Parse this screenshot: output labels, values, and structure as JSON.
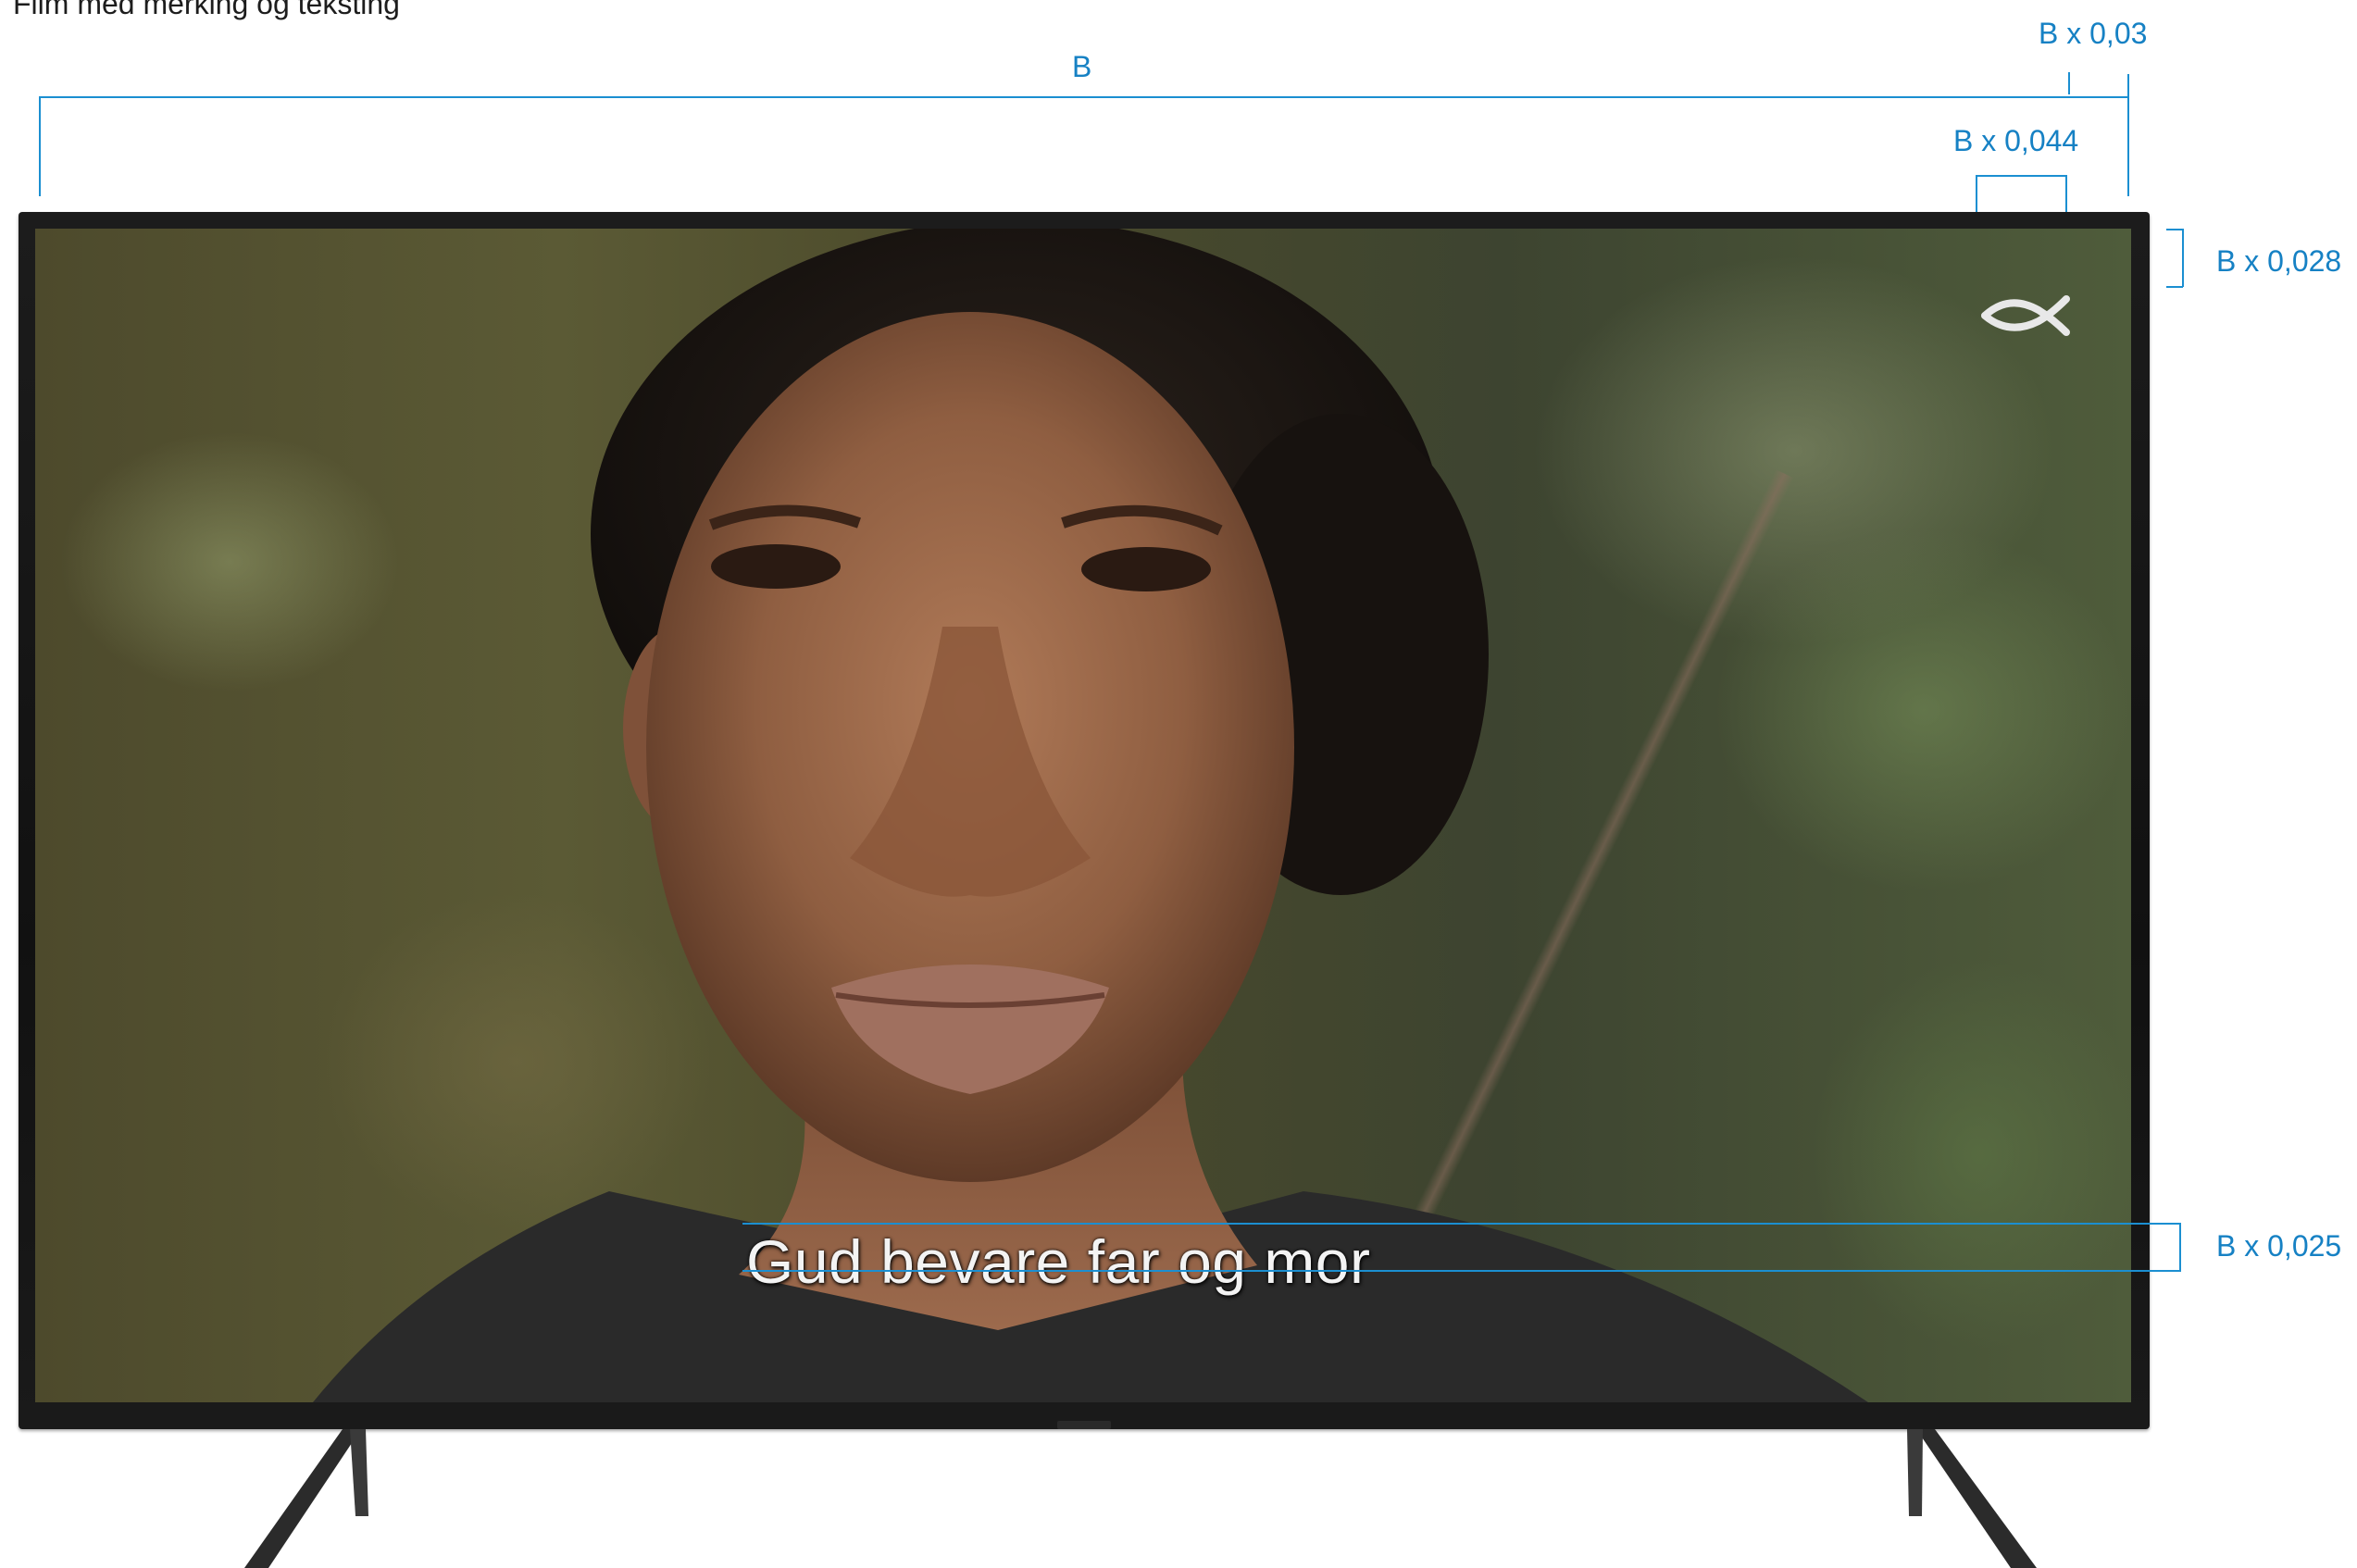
{
  "page": {
    "caption": "Film med merking og teksting"
  },
  "dimensions": {
    "width_label": "B",
    "logo_margin_label": "B x 0,03",
    "logo_width_label": "B x 0,044",
    "logo_height_label": "B x 0,028",
    "subtitle_height_label": "B x 0,025"
  },
  "screen": {
    "subtitle": "Gud bevare far og mor",
    "logo_icon": "fish-icon"
  },
  "colors": {
    "dimension_lines": "#1b8fd1",
    "dimension_text": "#1681c4",
    "bezel": "#141414"
  }
}
